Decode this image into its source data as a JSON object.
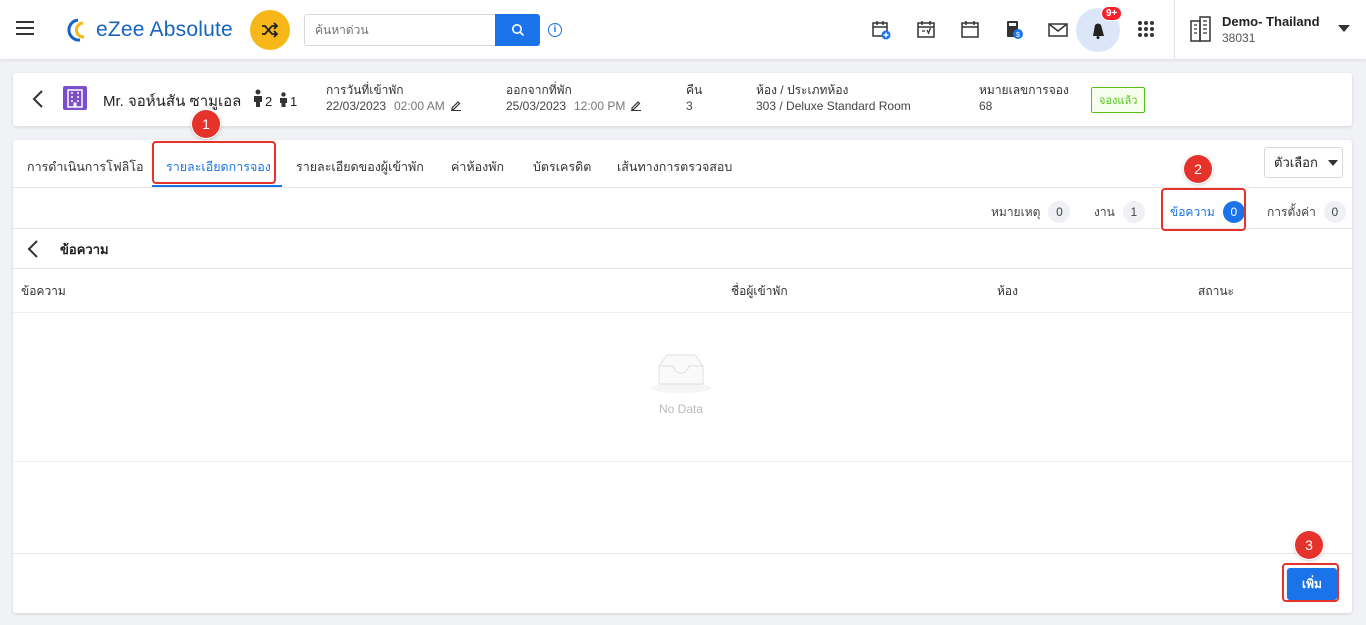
{
  "app": {
    "brand": "eZee Absolute",
    "search_placeholder": "ค้นหาด่วน",
    "info_glyph": "i",
    "notification_badge": "9+",
    "property_name": "Demo- Thailand",
    "property_code": "38031"
  },
  "booking": {
    "guest_name": "Mr. จอห์นสัน ซามูเอล",
    "adults": "2",
    "children": "1",
    "checkin_label": "การวันที่เข้าพัก",
    "checkin_date": "22/03/2023",
    "checkin_time": "02:00 AM",
    "checkout_label": "ออกจากที่พัก",
    "checkout_date": "25/03/2023",
    "checkout_time": "12:00 PM",
    "nights_label": "คืน",
    "nights": "3",
    "room_label": "ห้อง / ประเภทห้อง",
    "room": "303 / Deluxe Standard Room",
    "res_no_label": "หมายเลขการจอง",
    "res_no": "68",
    "status": "จองแล้ว"
  },
  "tabs": [
    {
      "label": "การดำเนินการโฟลิโอ"
    },
    {
      "label": "รายละเอียดการจอง"
    },
    {
      "label": "รายละเอียดของผู้เข้าพัก"
    },
    {
      "label": "ค่าห้องพัก"
    },
    {
      "label": "บัตรเครดิต"
    },
    {
      "label": "เส้นทางการตรวจสอบ"
    }
  ],
  "options_label": "ตัวเลือก",
  "subtabs": [
    {
      "label": "หมายเหตุ",
      "count": "0"
    },
    {
      "label": "งาน",
      "count": "1"
    },
    {
      "label": "ข้อความ",
      "count": "0"
    },
    {
      "label": "การตั้งค่า",
      "count": "0"
    }
  ],
  "section_title": "ข้อความ",
  "table": {
    "columns": [
      "ข้อความ",
      "ชื่อผู้เข้าพัก",
      "ห้อง",
      "สถานะ"
    ],
    "empty_text": "No Data"
  },
  "add_button": "เพิ่ม",
  "callouts": [
    "1",
    "2",
    "3"
  ],
  "colors": {
    "accent": "#1a73e8",
    "callout": "#e5322b",
    "confirmed": "#52c41a",
    "shuffle": "#f7b719"
  }
}
